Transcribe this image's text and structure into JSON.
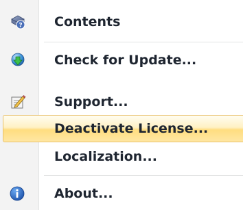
{
  "menu": {
    "items": [
      {
        "label": "Contents",
        "icon": "help-book-icon"
      },
      {
        "label": "Check for Update...",
        "icon": "download-update-icon"
      },
      {
        "label": "Support...",
        "icon": "support-edit-icon"
      },
      {
        "label": "Deactivate License...",
        "icon": ""
      },
      {
        "label": "Localization...",
        "icon": ""
      },
      {
        "label": "About...",
        "icon": "info-icon"
      }
    ],
    "highlighted_index": 3,
    "colors": {
      "highlight_border": "#e8c06a",
      "highlight_fill": "#ffe7a3",
      "text": "#1e2530",
      "gutter": "#f3f3f3"
    }
  }
}
